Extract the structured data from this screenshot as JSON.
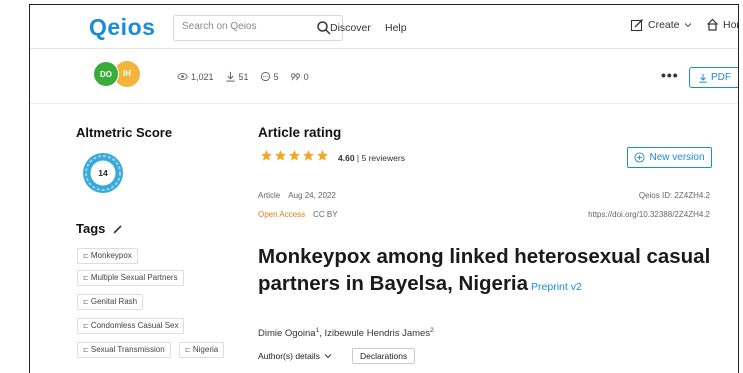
{
  "header": {
    "logo": "Qeios",
    "search_placeholder": "Search on Qeios",
    "nav": {
      "discover": "Discover",
      "help": "Help"
    },
    "create": "Create",
    "home": "Hor"
  },
  "subbar": {
    "avatars": [
      "DO",
      "IH"
    ],
    "stats": {
      "views": "1,021",
      "downloads": "51",
      "comments": "5",
      "reviews": "0"
    },
    "more": "•••",
    "pdf": "PDF"
  },
  "sidebar": {
    "altmetric_title": "Altmetric Score",
    "altmetric_score": "14",
    "tags_title": "Tags",
    "tags": [
      "Monkeypox",
      "Multiple Sexual Partners",
      "Genital Rash",
      "Condomless Casual Sex",
      "Sexual Transmission",
      "Nigeria"
    ]
  },
  "article": {
    "rating_title": "Article rating",
    "rating_value": "4.60",
    "rating_reviewers": "5 reviewers",
    "stars": 5,
    "new_version": "New version",
    "type": "Article",
    "date": "Aug 24, 2022",
    "qeios_id": "Qeios ID: 2Z4ZH4.2",
    "open_access": "Open Access",
    "license": "CC BY",
    "doi": "https://doi.org/10.32388/2Z4ZH4.2",
    "title": "Monkeypox among linked heterosexual casual partners in Bayelsa, Nigeria",
    "preprint": "Preprint v2",
    "author1": "Dimie Ogoina",
    "author1_sup": "1",
    "author2": "Izibewule Hendris James",
    "author2_sup": "2",
    "author_details": "Author(s) details",
    "declarations": "Declarations"
  },
  "colors": {
    "brand": "#1a8bd8",
    "accent_orange": "#e07b1f",
    "star": "#f5a623"
  }
}
